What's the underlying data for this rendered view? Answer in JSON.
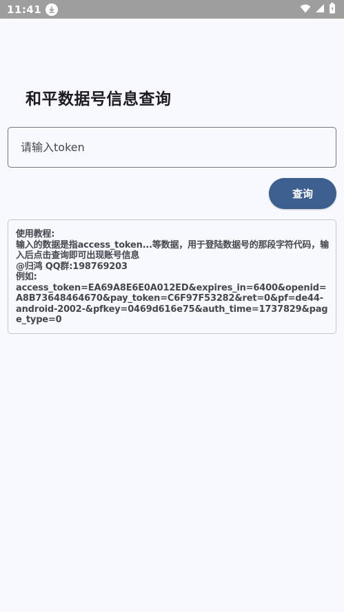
{
  "status_bar": {
    "time": "11:41",
    "icons": [
      "download-icon",
      "wifi-icon",
      "signal-icon",
      "battery-icon"
    ]
  },
  "page": {
    "title": "和平数据号信息查询"
  },
  "token_input": {
    "placeholder": "请输入token",
    "value": ""
  },
  "query_button": {
    "label": "查询"
  },
  "info_card": {
    "lines": [
      "使用教程:",
      "输入的数据是指access_token...等数据，用于登陆数据号的那段字符代码，输入后点击查询即可出现账号信息",
      "@归鸿  QQ群:198769203",
      "例如:",
      "access_token=EA69A8E6E0A012ED&expires_in=6400&openid=A8B73648464670&pay_token=C6F97F53282&ret=0&pf=de44-android-2002-&pfkey=0469d616e75&auth_time=1737829&page_type=0"
    ]
  },
  "colors": {
    "background": "#f8f9ff",
    "status_bar": "#9e9e9e",
    "primary_button": "#3d5f8f",
    "text": "#1c1b1f"
  }
}
